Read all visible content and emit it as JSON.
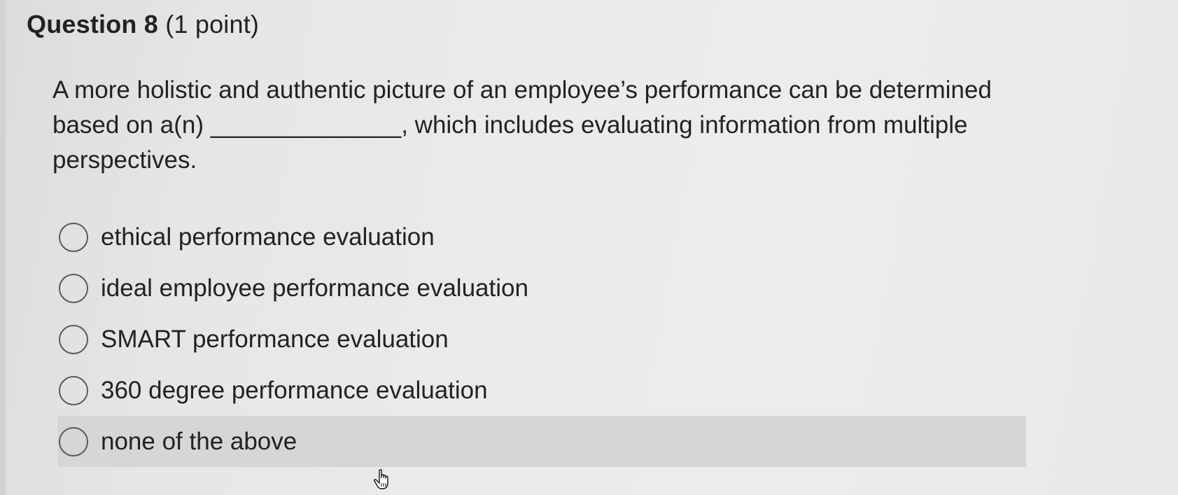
{
  "question": {
    "title": "Question 8",
    "points": "(1 point)",
    "text": "A more holistic and authentic picture of an employee’s performance can be determined based on a(n) ______________, which includes evaluating information from multiple perspectives."
  },
  "options": [
    {
      "label": "ethical performance evaluation",
      "selected": false
    },
    {
      "label": "ideal employee performance evaluation",
      "selected": false
    },
    {
      "label": "SMART performance evaluation",
      "selected": false
    },
    {
      "label": "360 degree performance evaluation",
      "selected": false
    },
    {
      "label": "none of the above",
      "selected": false,
      "hovered": true
    }
  ],
  "colors": {
    "hover_row": "#d6d6d6",
    "text": "#222222",
    "radio_border": "#5a5a5a"
  },
  "icons": {
    "cursor": "hand-pointer-icon"
  }
}
